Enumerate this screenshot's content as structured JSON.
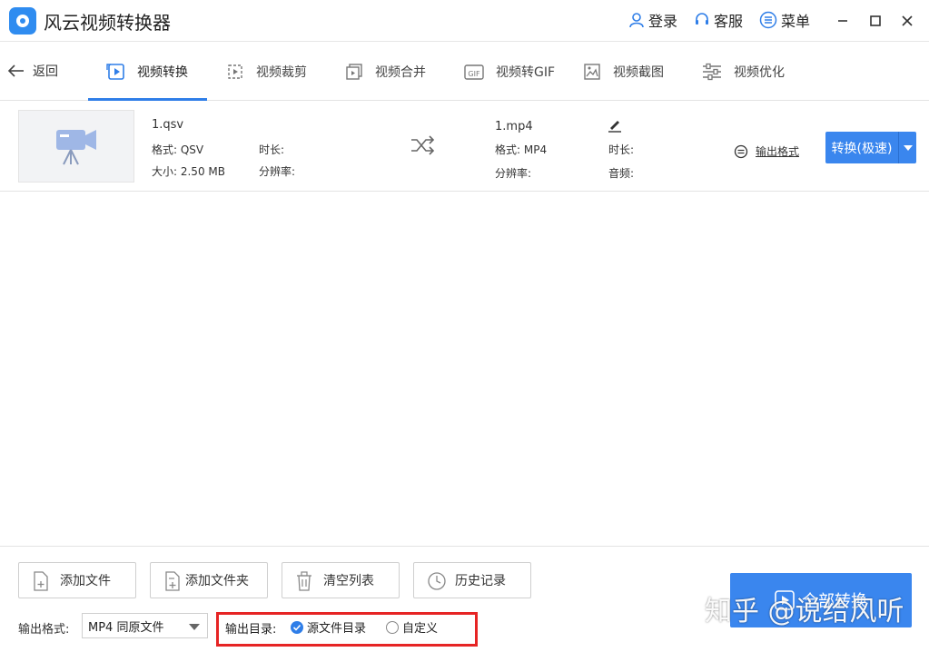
{
  "app": {
    "title": "风云视频转换器",
    "accent_color": "#3a86ee",
    "highlight_color": "#e62424"
  },
  "header": {
    "login": {
      "label": "登录",
      "icon": "user-icon"
    },
    "service": {
      "label": "客服",
      "icon": "headset-icon"
    },
    "menu": {
      "label": "菜单",
      "icon": "menu-icon"
    },
    "window_controls": [
      "minimize-icon",
      "maximize-icon",
      "close-icon"
    ]
  },
  "toolbar": {
    "back_label": "返回",
    "tabs": [
      {
        "label": "视频转换",
        "icon": "video-convert-icon",
        "active": true
      },
      {
        "label": "视频裁剪",
        "icon": "video-crop-icon",
        "active": false
      },
      {
        "label": "视频合并",
        "icon": "video-merge-icon",
        "active": false
      },
      {
        "label": "视频转GIF",
        "icon": "gif-icon",
        "active": false
      },
      {
        "label": "视频截图",
        "icon": "screenshot-icon",
        "active": false
      },
      {
        "label": "视频优化",
        "icon": "optimize-icon",
        "active": false
      }
    ]
  },
  "file": {
    "source": {
      "name": "1.qsv",
      "format_label": "格式: QSV",
      "size_label": "大小: 2.50 MB",
      "duration_label": "时长:",
      "resolution_label": "分辨率:"
    },
    "target": {
      "name": "1.mp4",
      "format_label": "格式: MP4",
      "resolution_label": "分辨率:",
      "duration_label": "时长:",
      "audio_label": "音频:"
    },
    "output_format_label": "输出格式",
    "convert_label": "转换(极速)"
  },
  "bottom": {
    "buttons": [
      {
        "label": "添加文件",
        "icon": "add-file-icon"
      },
      {
        "label": "添加文件夹",
        "icon": "add-folder-icon"
      },
      {
        "label": "清空列表",
        "icon": "trash-icon"
      },
      {
        "label": "历史记录",
        "icon": "clock-icon"
      }
    ],
    "format_label": "输出格式:",
    "format_value": "MP4 同原文件",
    "output_dir_label": "输出目录:",
    "dir_options": [
      {
        "label": "源文件目录",
        "selected": true
      },
      {
        "label": "自定义",
        "selected": false
      }
    ],
    "convert_all_label": "全部转换"
  },
  "watermark": "知乎 @说给风听"
}
